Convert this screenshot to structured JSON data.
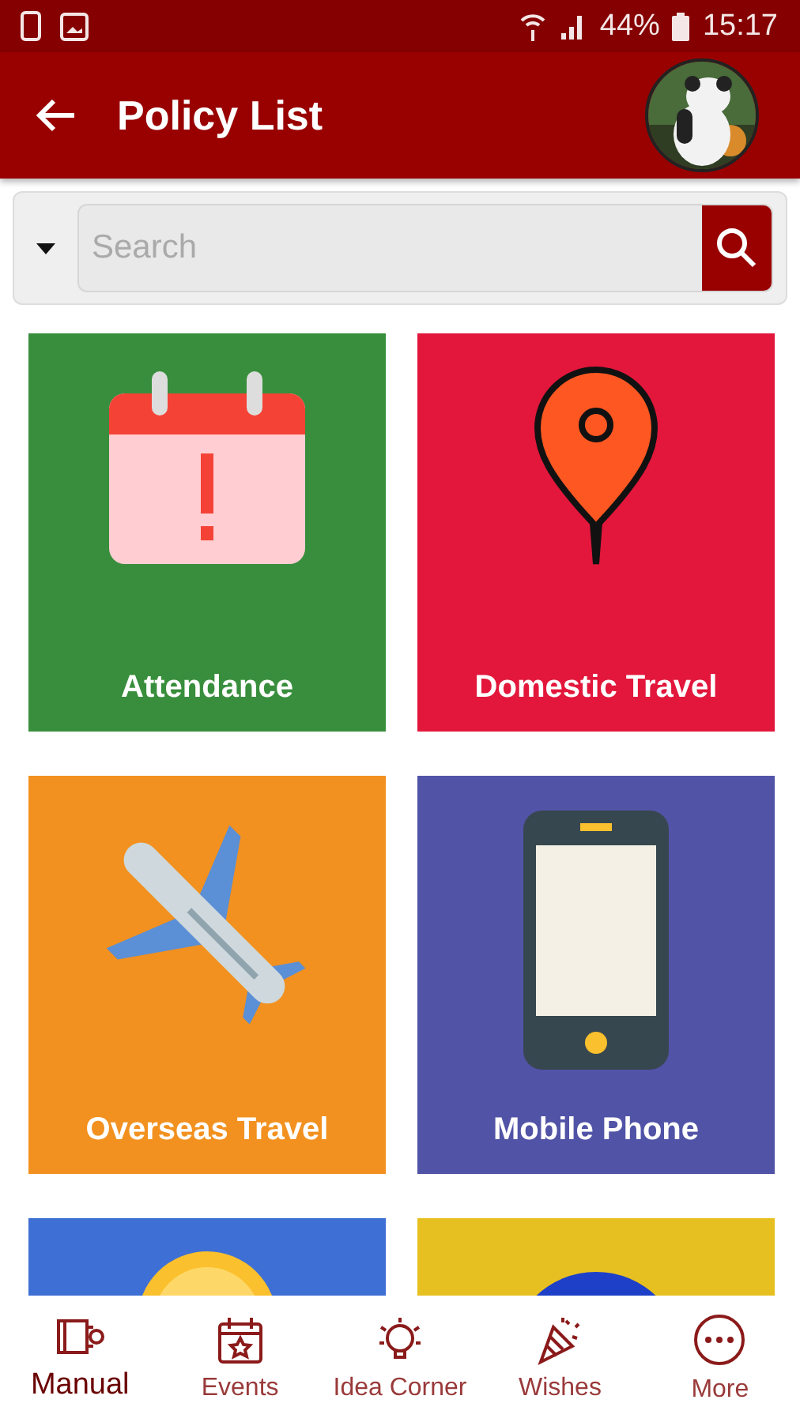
{
  "status_bar": {
    "battery": "44%",
    "time": "15:17"
  },
  "app_bar": {
    "title": "Policy List"
  },
  "search": {
    "placeholder": "Search"
  },
  "tiles": [
    {
      "label": "Attendance",
      "kind": "calendar",
      "color": "#388e3c"
    },
    {
      "label": "Domestic Travel",
      "kind": "pin",
      "color": "#e2173b"
    },
    {
      "label": "Overseas Travel",
      "kind": "plane",
      "color": "#f2911f"
    },
    {
      "label": "Mobile Phone",
      "kind": "phone",
      "color": "#5153a6"
    },
    {
      "kind": "coin",
      "color": "#3e6fd4"
    },
    {
      "kind": "globe",
      "color": "#e6c020"
    }
  ],
  "nav": [
    {
      "label": "Manual",
      "kind": "manual",
      "selected": true
    },
    {
      "label": "Events",
      "kind": "events",
      "selected": false
    },
    {
      "label": "Idea Corner",
      "kind": "idea",
      "selected": false
    },
    {
      "label": "Wishes",
      "kind": "wishes",
      "selected": false
    },
    {
      "label": "More",
      "kind": "more",
      "selected": false
    }
  ]
}
